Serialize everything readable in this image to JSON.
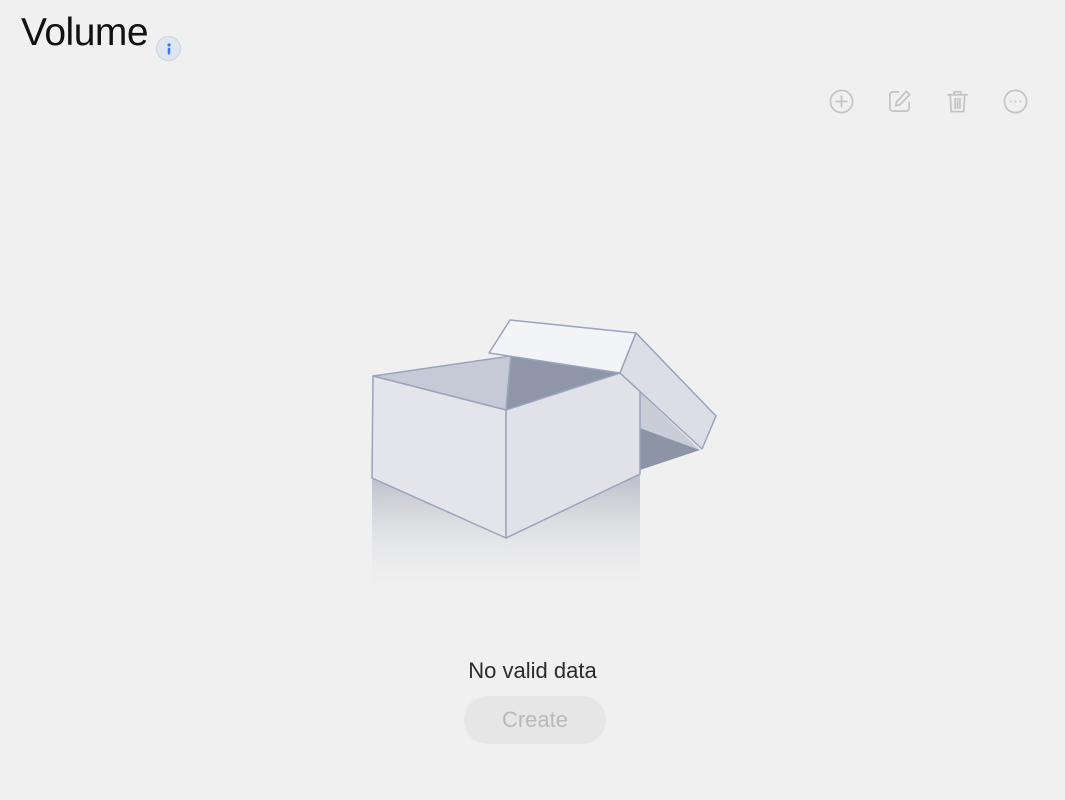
{
  "header": {
    "title": "Volume",
    "info_icon": "info-icon"
  },
  "toolbar": {
    "items": [
      {
        "name": "add",
        "icon": "plus-circle-icon"
      },
      {
        "name": "edit",
        "icon": "edit-icon"
      },
      {
        "name": "delete",
        "icon": "trash-icon"
      },
      {
        "name": "more",
        "icon": "more-horizontal-icon"
      }
    ],
    "disabled_color": "#c4c4c4"
  },
  "empty_state": {
    "illustration": "empty-box-illustration",
    "message": "No valid data",
    "create_label": "Create"
  },
  "colors": {
    "background": "#f0f0f0",
    "accent": "#3b7be8"
  }
}
